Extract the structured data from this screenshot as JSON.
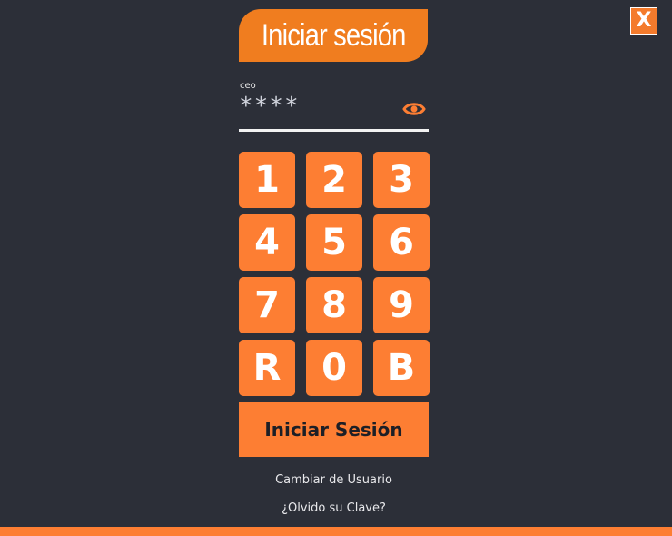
{
  "header": {
    "title": "Iniciar sesión",
    "close_label": "X"
  },
  "login": {
    "username": "ceo",
    "password_masked": "****",
    "show_password_icon": "eye-icon"
  },
  "keypad": {
    "keys": [
      "1",
      "2",
      "3",
      "4",
      "5",
      "6",
      "7",
      "8",
      "9",
      "R",
      "0",
      "B"
    ]
  },
  "actions": {
    "submit_label": "Iniciar Sesión",
    "change_user_label": "Cambiar de Usuario",
    "forgot_password_label": "¿Olvido su Clave?"
  },
  "colors": {
    "background": "#2c2f38",
    "accent": "#fd7e33",
    "banner": "#f07d1f"
  }
}
